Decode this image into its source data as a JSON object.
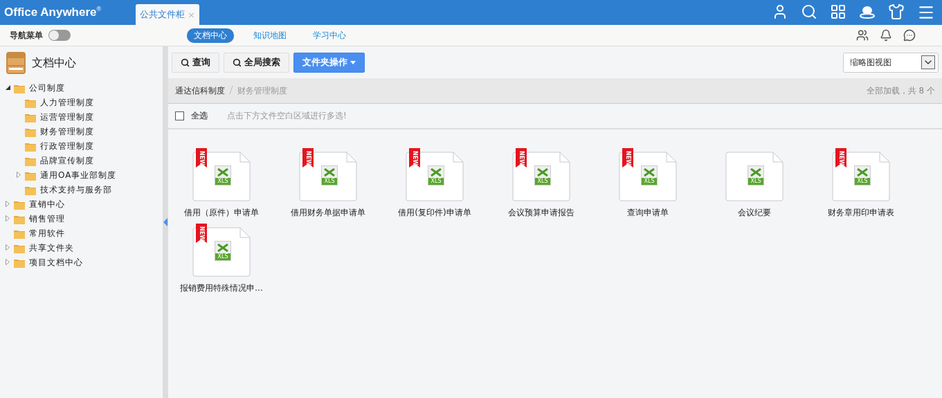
{
  "app": {
    "logo": "Office Anywhere",
    "logo_mark": "®"
  },
  "window_tabs": [
    {
      "label": "公共文件柜",
      "selected": true,
      "close": "×"
    }
  ],
  "nav_toggle": {
    "label": "导航菜单",
    "on": false
  },
  "center_tabs": [
    {
      "label": "文档中心",
      "selected": true
    },
    {
      "label": "知识地图",
      "selected": false
    },
    {
      "label": "学习中心",
      "selected": false
    }
  ],
  "sidebar": {
    "title": "文档中心",
    "tree": [
      {
        "label": "公司制度",
        "expanded": true,
        "children": [
          {
            "label": "人力管理制度"
          },
          {
            "label": "运营管理制度"
          },
          {
            "label": "财务管理制度"
          },
          {
            "label": "行政管理制度"
          },
          {
            "label": "品牌宣传制度"
          },
          {
            "label": "通用OA事业部制度",
            "expanded": false
          },
          {
            "label": "技术支持与服务部"
          }
        ]
      },
      {
        "label": "直销中心",
        "expanded": false
      },
      {
        "label": "销售管理",
        "expanded": false
      },
      {
        "label": "常用软件"
      },
      {
        "label": "共享文件夹",
        "expanded": false
      },
      {
        "label": "项目文档中心",
        "expanded": false
      }
    ]
  },
  "toolbar": {
    "buttons": [
      {
        "kind": "search",
        "label": "查询"
      },
      {
        "kind": "search",
        "label": "全局搜索"
      },
      {
        "kind": "dropdown",
        "label": "文件夹操作"
      }
    ],
    "view_select": "缩略图视图"
  },
  "breadcrumb": [
    {
      "label": "通达信科制度",
      "current": false
    },
    {
      "label": "财务管理制度",
      "current": true
    }
  ],
  "summary": "全部加载，共 8 个",
  "select_all": {
    "label": "全选",
    "checked": false,
    "hint": "点击下方文件空白区域进行多选!"
  },
  "files": [
    {
      "name": "借用（原件）申请单",
      "badge": "NEW",
      "type_label": "XLS"
    },
    {
      "name": "借用财务单据申请单",
      "badge": "NEW",
      "type_label": "XLS"
    },
    {
      "name": "借用(复印件)申请单",
      "badge": "NEW",
      "type_label": "XLS"
    },
    {
      "name": "会议预算申请报告",
      "badge": "NEW",
      "type_label": "XLS"
    },
    {
      "name": "查询申请单",
      "badge": "NEW",
      "type_label": "XLS"
    },
    {
      "name": "会议纪要",
      "type_label": "XLS"
    },
    {
      "name": "财务章用印申请表",
      "badge": "NEW",
      "type_label": "XLS"
    },
    {
      "name": "报销费用特殊情况申…",
      "badge": "NEW",
      "type_label": "XLS"
    }
  ]
}
